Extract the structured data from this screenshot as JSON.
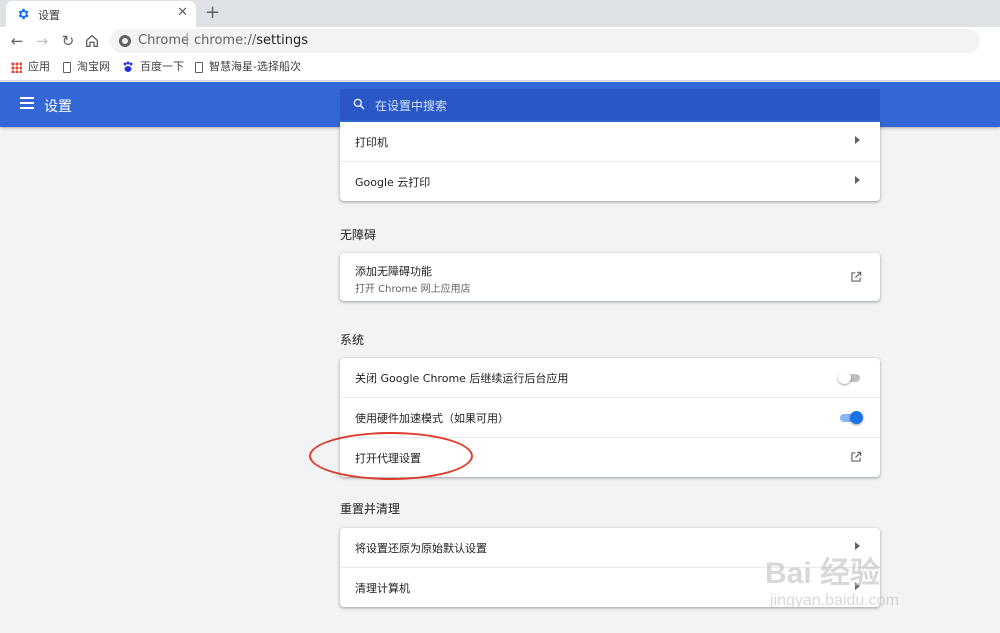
{
  "browser": {
    "tab_title": "设置",
    "omnibox": {
      "host": "Chrome",
      "separator": "|",
      "url_scheme": "chrome://",
      "url_path": "settings"
    }
  },
  "bookmarks": [
    {
      "label": "应用",
      "icon": "apps-grid-icon"
    },
    {
      "label": "淘宝网",
      "icon": "page-icon"
    },
    {
      "label": "百度一下",
      "icon": "baidu-paw-icon"
    },
    {
      "label": "智慧海星-选择船次",
      "icon": "page-icon"
    }
  ],
  "header": {
    "title": "设置",
    "search_placeholder": "在设置中搜索"
  },
  "printing": {
    "rows": [
      {
        "label": "打印机"
      },
      {
        "label": "Google 云打印"
      }
    ]
  },
  "accessibility": {
    "title": "无障碍",
    "row": {
      "label": "添加无障碍功能",
      "sub": "打开 Chrome 网上应用店"
    }
  },
  "system": {
    "title": "系统",
    "rows": [
      {
        "label": "关闭 Google Chrome 后继续运行后台应用",
        "toggle": false
      },
      {
        "label": "使用硬件加速模式（如果可用）",
        "toggle": true
      },
      {
        "label": "打开代理设置"
      }
    ]
  },
  "reset": {
    "title": "重置并清理",
    "rows": [
      {
        "label": "将设置还原为原始默认设置"
      },
      {
        "label": "清理计算机"
      }
    ]
  },
  "watermark": {
    "main": "Bai 经验",
    "sub": "jingyan.baidu.com"
  },
  "colors": {
    "header_bg": "#3367d6",
    "toggle_on": "#1a73e8",
    "annotation": "#e03a2b"
  }
}
